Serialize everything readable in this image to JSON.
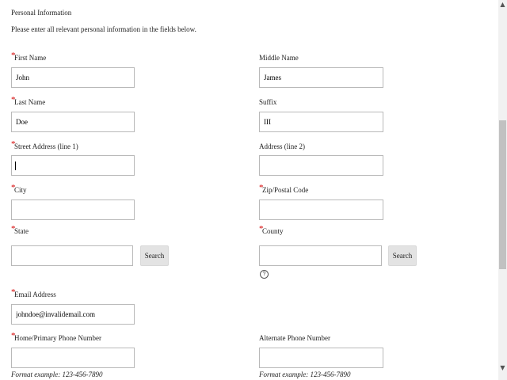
{
  "section": {
    "title": "Personal Information",
    "instructions": "Please enter all relevant personal information in the fields below."
  },
  "required_marker": "*",
  "fields": {
    "first_name": {
      "label": "First Name",
      "value": "John"
    },
    "middle_name": {
      "label": "Middle Name",
      "value": "James"
    },
    "last_name": {
      "label": "Last Name",
      "value": "Doe"
    },
    "suffix": {
      "label": "Suffix",
      "value": "III"
    },
    "street1": {
      "label": "Street Address (line 1)",
      "value": ""
    },
    "street2": {
      "label": "Address (line 2)",
      "value": ""
    },
    "city": {
      "label": "City",
      "value": ""
    },
    "zip": {
      "label": "Zip/Postal Code",
      "value": ""
    },
    "state": {
      "label": "State",
      "value": ""
    },
    "county": {
      "label": "County",
      "value": ""
    },
    "email": {
      "label": "Email Address",
      "value": "johndoe@invalidemail.com"
    },
    "home_phone": {
      "label": "Home/Primary Phone Number",
      "value": ""
    },
    "alt_phone": {
      "label": "Alternate Phone Number",
      "value": ""
    }
  },
  "buttons": {
    "state_search": "Search",
    "county_search": "Search"
  },
  "help_icon": {
    "glyph": "?"
  },
  "phone_hint": "Format example:  123-456-7890",
  "scrollbar": {
    "up_arrow": "▲",
    "down_arrow": "▼"
  }
}
